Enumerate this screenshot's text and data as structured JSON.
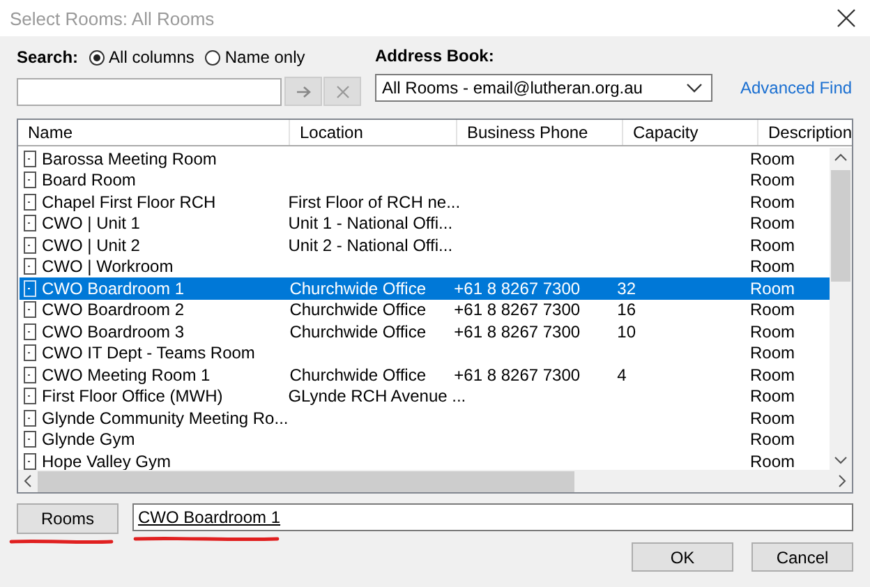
{
  "window": {
    "title": "Select Rooms: All Rooms"
  },
  "search": {
    "label": "Search:",
    "options": [
      {
        "label": "All columns",
        "selected": true
      },
      {
        "label": "Name only",
        "selected": false
      }
    ]
  },
  "address_book": {
    "label": "Address Book:",
    "value": "All Rooms - email@lutheran.org.au"
  },
  "advanced_find": "Advanced Find",
  "table": {
    "columns": [
      "Name",
      "Location",
      "Business Phone",
      "Capacity",
      "Description"
    ],
    "rows": [
      {
        "name": "Barossa Meeting Room",
        "location": "",
        "phone": "",
        "capacity": "",
        "description": "Room",
        "selected": false
      },
      {
        "name": "Board Room",
        "location": "",
        "phone": "",
        "capacity": "",
        "description": "Room",
        "selected": false
      },
      {
        "name": "Chapel First Floor RCH",
        "location": "First Floor of RCH ne...",
        "phone": "",
        "capacity": "",
        "description": "Room",
        "selected": false
      },
      {
        "name": "CWO | Unit 1",
        "location": "Unit 1 - National Offi...",
        "phone": "",
        "capacity": "",
        "description": "Room",
        "selected": false
      },
      {
        "name": "CWO | Unit 2",
        "location": "Unit 2 - National Offi...",
        "phone": "",
        "capacity": "",
        "description": "Room",
        "selected": false
      },
      {
        "name": "CWO | Workroom",
        "location": "",
        "phone": "",
        "capacity": "",
        "description": "Room",
        "selected": false
      },
      {
        "name": "CWO Boardroom 1",
        "location": "Churchwide Office",
        "phone": "+61 8 8267 7300",
        "capacity": "32",
        "description": "Room",
        "selected": true
      },
      {
        "name": "CWO Boardroom 2",
        "location": "Churchwide Office",
        "phone": "+61 8 8267 7300",
        "capacity": "16",
        "description": "Room",
        "selected": false
      },
      {
        "name": "CWO Boardroom 3",
        "location": "Churchwide Office",
        "phone": "+61 8 8267 7300",
        "capacity": "10",
        "description": "Room",
        "selected": false
      },
      {
        "name": "CWO IT Dept - Teams Room",
        "location": "",
        "phone": "",
        "capacity": "",
        "description": "Room",
        "selected": false
      },
      {
        "name": "CWO Meeting Room 1",
        "location": "Churchwide Office",
        "phone": "+61 8 8267 7300",
        "capacity": "4",
        "description": "Room",
        "selected": false
      },
      {
        "name": "First Floor Office (MWH)",
        "location": "GLynde RCH Avenue ...",
        "phone": "",
        "capacity": "",
        "description": "Room",
        "selected": false
      },
      {
        "name": "Glynde Community Meeting Ro...",
        "location": "",
        "phone": "",
        "capacity": "",
        "description": "Room",
        "selected": false
      },
      {
        "name": "Glynde Gym",
        "location": "",
        "phone": "",
        "capacity": "",
        "description": "Room",
        "selected": false
      },
      {
        "name": "Hope Valley Gym",
        "location": "",
        "phone": "",
        "capacity": "",
        "description": "Room",
        "selected": false
      }
    ]
  },
  "rooms_button": "Rooms",
  "rooms_field": {
    "value": "CWO Boardroom 1"
  },
  "buttons": [
    "OK",
    "Cancel"
  ]
}
